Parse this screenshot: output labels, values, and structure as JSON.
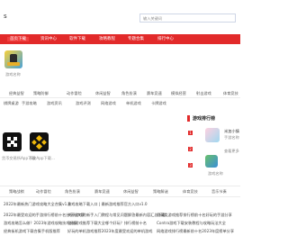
{
  "header": {
    "logo_text": "s",
    "search_placeholder": "输入关键词"
  },
  "nav": {
    "items": [
      "首页下载",
      "资讯中心",
      "软件下载",
      "攻略教程",
      "专题合集",
      "排行中心"
    ]
  },
  "featured": {
    "app_name": "游戏名称"
  },
  "categories_row1": [
    "经典益智",
    "策略防御",
    "动作冒险",
    "休闲益智",
    "角色扮演",
    "赛车竞速",
    "模拟经营",
    "射击游戏",
    "体育竞技",
    "音乐节奏"
  ],
  "categories_row2": [
    "棋牌桌游",
    "手游攻略",
    "游戏资讯",
    "游戏评测",
    "网络游戏",
    "单机游戏",
    "卡牌游戏"
  ],
  "apps": [
    {
      "name": "货币交易所App下载"
    },
    {
      "name": "币安App下载..."
    }
  ],
  "rank": {
    "title": "游戏排行榜",
    "items": [
      {
        "name": "米加小镇"
      },
      {
        "name": "手游名称"
      },
      {
        "name": "游戏名称"
      }
    ],
    "more_label": "查看更多"
  },
  "bottom_tabs": [
    "策略战棋",
    "动作冒险",
    "角色扮演",
    "赛车竞速",
    "休闲益智",
    "策略解谜",
    "体育竞技",
    "音乐节奏"
  ],
  "news": [
    {
      "left": "2022年最新热门游戏攻略大全合集v1.0",
      "mid": "游戏攻略下载入口 | 最新游戏推荐官方入口v1.0"
    },
    {
      "left": "2022年最受欢迎的手游排行榜前十名分享给大家",
      "mid": "关于游戏的新手入门教程与常见问题解答最新内容汇总下载",
      "right": "收藏类游戏推荐排行榜前十名好玩的手游分享"
    },
    {
      "left": "游戏攻略怎么做？2023年游戏攻略技巧分享",
      "mid": "电脑游戏推荐下载大全哪个好玩？排行榜前十名",
      "right": "Contra游戏下载安装教程与攻略玩法大全"
    },
    {
      "left": "经典街机游戏下载合集手机版推荐",
      "mid": "好玩的单机游戏推荐2023年度最受欢迎的单机游戏",
      "right": "网络游戏排行榜最新前十名2023年度榜单分享"
    }
  ],
  "colors": {
    "nav_bg": "#e22a2a",
    "accent": "#e22a2a"
  }
}
